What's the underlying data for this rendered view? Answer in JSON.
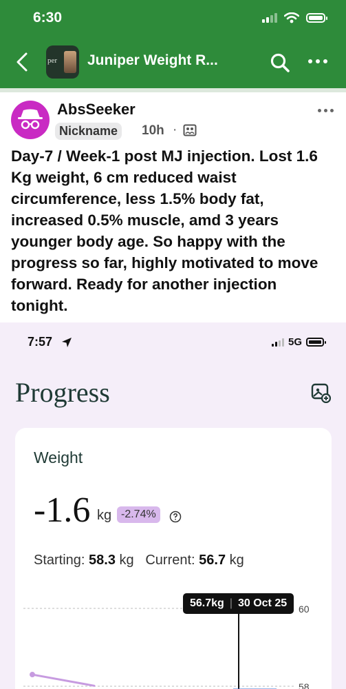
{
  "status": {
    "time": "6:30"
  },
  "header": {
    "title": "Juniper Weight R...",
    "avatar_text": "per"
  },
  "post": {
    "author": "AbsSeeker",
    "badge": "Nickname",
    "time": "10h",
    "dot": "·",
    "text": "Day-7 / Week-1 post MJ injection. Lost 1.6 Kg weight,  6 cm reduced waist circumference, less 1.5% body fat, increased 0.5% muscle, amd 3 years younger body age. So happy with the progress so far, highly motivated to move forward. Ready for another injection tonight."
  },
  "embedded": {
    "status_time": "7:57",
    "network": "5G",
    "page_title": "Progress",
    "card": {
      "label": "Weight",
      "delta": "-1.6",
      "unit": "kg",
      "percent": "-2.74%",
      "starting_label": "Starting:",
      "starting_value": "58.3",
      "current_label": "Current:",
      "current_value": "56.7",
      "kg": "kg"
    },
    "tooltip": {
      "weight": "56.7kg",
      "divider": "|",
      "date": "30 Oct 25"
    }
  },
  "chart_data": {
    "type": "line",
    "title": "Weight",
    "yticks": [
      60,
      58
    ],
    "series": [
      {
        "values": [
          58.3,
          56.7
        ]
      }
    ],
    "highlight": {
      "value": 56.7,
      "label": "56.7kg",
      "date": "30 Oct 25"
    }
  },
  "colors": {
    "header_green": "#2e8b3a",
    "avatar_magenta": "#c92ac3",
    "embedded_bg": "#f5eef9",
    "badge_purple": "#d8b8ec",
    "line_purple": "#c79be0",
    "line_blue": "#2f6fd6"
  },
  "icons": [
    "back-arrow-icon",
    "search-icon",
    "more-icon",
    "incognito-icon",
    "group-post-icon",
    "location-arrow-icon",
    "share-image-icon",
    "help-icon"
  ]
}
